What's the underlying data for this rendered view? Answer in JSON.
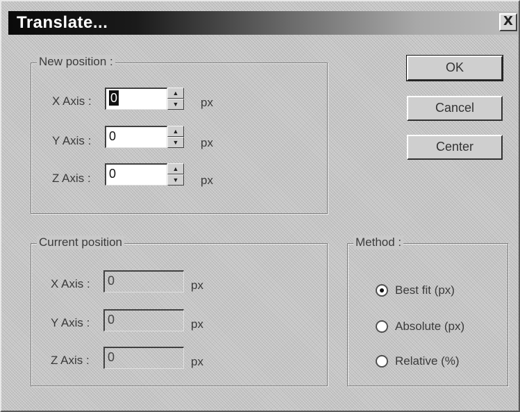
{
  "window": {
    "title": "Translate...",
    "close_glyph": "X"
  },
  "new_position": {
    "label": "New position :",
    "rows": [
      {
        "label": "X Axis :",
        "value": "0",
        "unit": "px"
      },
      {
        "label": "Y Axis :",
        "value": "0",
        "unit": "px"
      },
      {
        "label": "Z Axis :",
        "value": "0",
        "unit": "px"
      }
    ]
  },
  "current_position": {
    "label": "Current position",
    "rows": [
      {
        "label": "X Axis :",
        "value": "0",
        "unit": "px"
      },
      {
        "label": "Y Axis :",
        "value": "0",
        "unit": "px"
      },
      {
        "label": "Z Axis :",
        "value": "0",
        "unit": "px"
      }
    ]
  },
  "buttons": {
    "ok": "OK",
    "cancel": "Cancel",
    "center": "Center"
  },
  "method": {
    "label": "Method :",
    "options": [
      {
        "label": "Best fit (px)",
        "checked": true
      },
      {
        "label": "Absolute (px)",
        "checked": false
      },
      {
        "label": "Relative (%)",
        "checked": false
      }
    ]
  },
  "icons": {
    "spin_up": "spin-up-arrow-icon",
    "spin_down": "spin-down-arrow-icon",
    "close": "close-icon"
  }
}
